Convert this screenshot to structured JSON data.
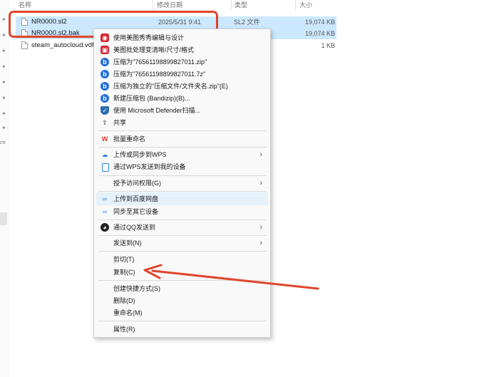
{
  "columns": {
    "name": "名称",
    "date": "修改日期",
    "type": "类型",
    "size": "大小"
  },
  "files": [
    {
      "name": "NR0000.sl2",
      "date": "2025/5/31 9:41",
      "type": "SL2 文件",
      "size": "19,074 KB"
    },
    {
      "name": "NR0000.sl2.bak",
      "date": "",
      "type": "",
      "size": "19,074 KB"
    },
    {
      "name": "steam_autocloud.vdf",
      "date": "",
      "type": "",
      "size": "1 KB"
    }
  ],
  "gutter_text": "ctr",
  "menu": {
    "items": [
      {
        "label": "使用美图秀秀编辑与设计",
        "icon": "meitu-icon"
      },
      {
        "label": "美图批处理变清晰/尺寸/格式",
        "icon": "meitu-icon"
      },
      {
        "label": "压缩为\"76561198899827011.zip\"",
        "icon": "bandizip-icon"
      },
      {
        "label": "压缩为\"76561198899827011.7z\"",
        "icon": "bandizip-icon"
      },
      {
        "label": "压缩为独立的\"压缩文件/文件夹名.zip\"(E)",
        "icon": "bandizip-icon"
      },
      {
        "label": "新建压缩包 (Bandizip)(B)...",
        "icon": "bandizip-icon"
      },
      {
        "label": "使用 Microsoft Defender扫描...",
        "icon": "defender-shield-icon"
      },
      {
        "label": "共享",
        "icon": "share-icon"
      },
      {
        "label": "批量重命名",
        "icon": "wps-icon"
      },
      {
        "label": "上传或同步到WPS",
        "icon": "cloud-icon"
      },
      {
        "label": "通过WPS发送到我的设备",
        "icon": "device-icon"
      },
      {
        "label": "授予访问权限(G)"
      },
      {
        "label": "上传到百度网盘",
        "icon": "baidu-netdisk-icon"
      },
      {
        "label": "同步至其它设备",
        "icon": "baidu-netdisk-icon"
      },
      {
        "label": "通过QQ发送到",
        "icon": "qq-icon"
      },
      {
        "label": "发送到(N)"
      },
      {
        "label": "剪切(T)"
      },
      {
        "label": "复制(C)"
      },
      {
        "label": "创建快捷方式(S)"
      },
      {
        "label": "删除(D)"
      },
      {
        "label": "重命名(M)"
      },
      {
        "label": "属性(R)"
      }
    ]
  },
  "colors": {
    "annotation": "#e0452c",
    "selection": "#cce8ff",
    "hover": "#e5f1fb"
  }
}
